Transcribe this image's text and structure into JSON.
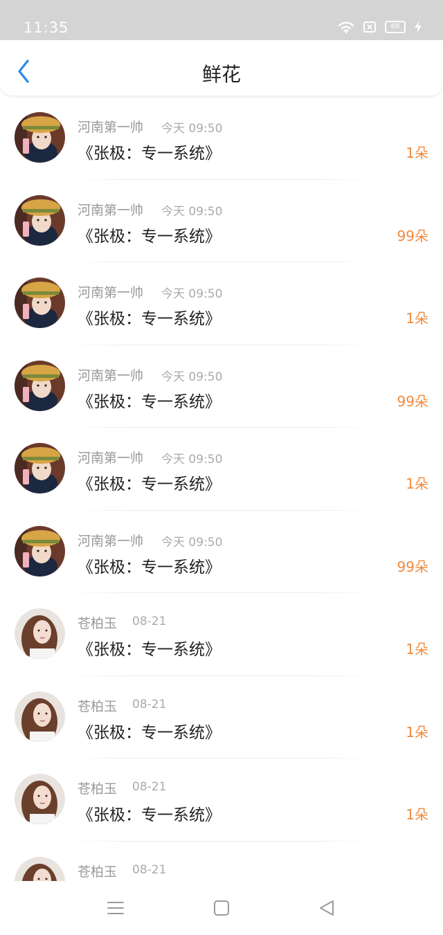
{
  "status_bar": {
    "time": "11:35",
    "battery": "69"
  },
  "header": {
    "title": "鲜花"
  },
  "items": [
    {
      "user": "河南第一帅",
      "time": "今天 09:50",
      "title": "《张极：专一系统》",
      "amount": "1朵",
      "avatar": "avatar-hat-girl"
    },
    {
      "user": "河南第一帅",
      "time": "今天 09:50",
      "title": "《张极：专一系统》",
      "amount": "99朵",
      "avatar": "avatar-hat-girl"
    },
    {
      "user": "河南第一帅",
      "time": "今天 09:50",
      "title": "《张极：专一系统》",
      "amount": "1朵",
      "avatar": "avatar-hat-girl"
    },
    {
      "user": "河南第一帅",
      "time": "今天 09:50",
      "title": "《张极：专一系统》",
      "amount": "99朵",
      "avatar": "avatar-hat-girl"
    },
    {
      "user": "河南第一帅",
      "time": "今天 09:50",
      "title": "《张极：专一系统》",
      "amount": "1朵",
      "avatar": "avatar-hat-girl"
    },
    {
      "user": "河南第一帅",
      "time": "今天 09:50",
      "title": "《张极：专一系统》",
      "amount": "99朵",
      "avatar": "avatar-hat-girl"
    },
    {
      "user": "苍柏玉",
      "time": "08-21",
      "title": "《张极：专一系统》",
      "amount": "1朵",
      "avatar": "avatar-long-hair-girl"
    },
    {
      "user": "苍柏玉",
      "time": "08-21",
      "title": "《张极：专一系统》",
      "amount": "1朵",
      "avatar": "avatar-long-hair-girl"
    },
    {
      "user": "苍柏玉",
      "time": "08-21",
      "title": "《张极：专一系统》",
      "amount": "1朵",
      "avatar": "avatar-long-hair-girl"
    },
    {
      "user": "苍柏玉",
      "time": "08-21",
      "title": "",
      "amount": "",
      "avatar": "avatar-long-hair-girl"
    }
  ],
  "colors": {
    "accent": "#2e8be6",
    "amount": "#f08a3c",
    "status_bar": "#d4d4d4"
  },
  "nav": {
    "icons": [
      "menu-icon",
      "home-square-icon",
      "back-triangle-icon"
    ]
  }
}
